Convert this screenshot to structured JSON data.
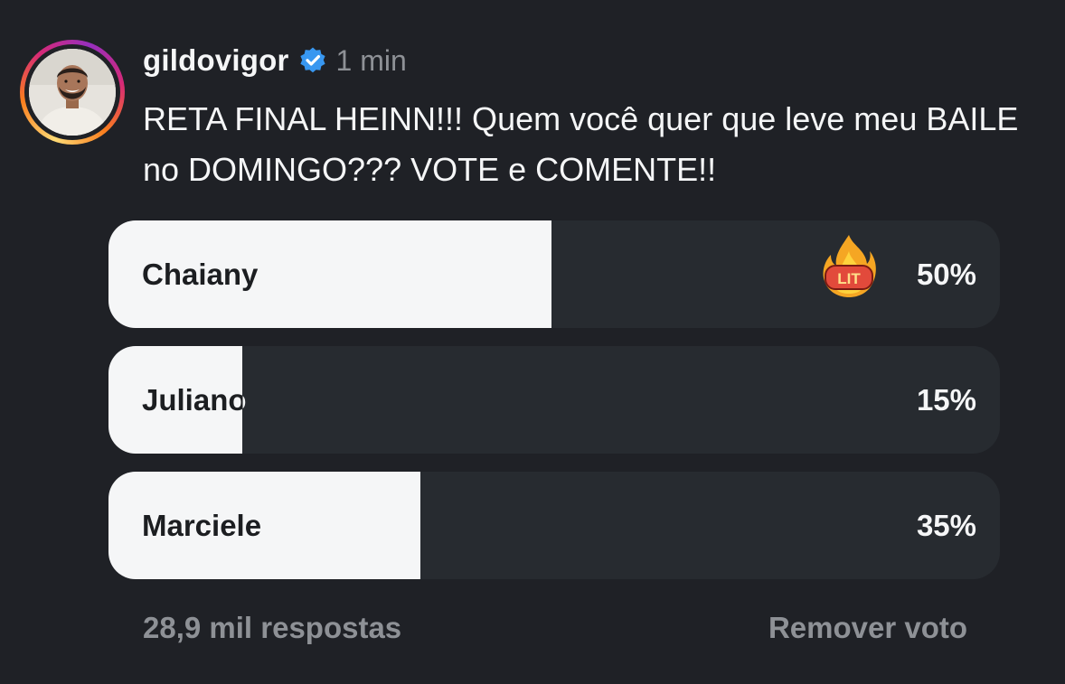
{
  "post": {
    "username": "gildovigor",
    "timestamp": "1 min",
    "text": "RETA FINAL HEINN!!! Quem você quer que leve meu BAILE no DOMINGO??? VOTE e COMENTE!!",
    "verified_icon": "verified-badge-icon",
    "avatar_icon": "profile-avatar"
  },
  "poll": {
    "options": [
      {
        "label": "Chaiany",
        "percent_text": "50%",
        "fill": 0.497,
        "badge_icon": "lit-fire-icon",
        "badge_text": "LIT"
      },
      {
        "label": "Juliano",
        "percent_text": "15%",
        "fill": 0.15
      },
      {
        "label": "Marciele",
        "percent_text": "35%",
        "fill": 0.35
      }
    ],
    "responses": "28,9 mil respostas",
    "remove_vote": "Remover voto"
  },
  "colors": {
    "background": "#1f2126",
    "bar_track": "#272b30",
    "bar_fill": "#f5f6f7",
    "verified_blue": "#3897f0",
    "muted_text": "#8e9196"
  }
}
